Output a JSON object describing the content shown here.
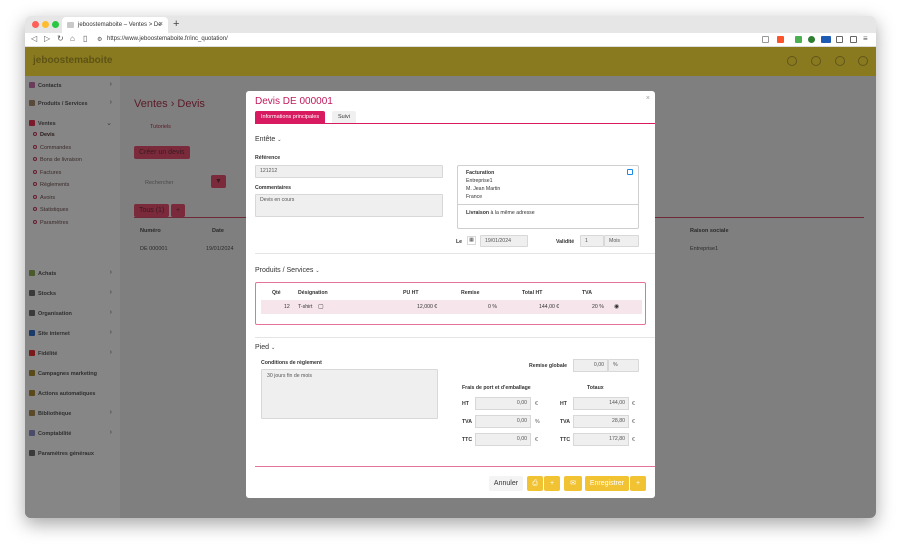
{
  "browser": {
    "tab_title": "jeboostemaboite – Ventes > De",
    "tab_close": "×",
    "new_tab": "+",
    "url": "https://www.jeboostemaboite.fr/inc_quotation/"
  },
  "app": {
    "logo": "jeboostemaboite",
    "sidebar": [
      {
        "label": "Contacts",
        "color": "#6a3b5a"
      },
      {
        "label": "Produits / Services",
        "color": "#5a4a3a"
      },
      {
        "label": "Ventes",
        "color": "#7a1a2a"
      },
      {
        "label": "Achats",
        "color": "#4a5a2a"
      },
      {
        "label": "Stocks",
        "color": "#3a3a3a"
      },
      {
        "label": "Organisation",
        "color": "#3a3a3a"
      },
      {
        "label": "Site internet",
        "color": "#1a3a6a"
      },
      {
        "label": "Fidélité",
        "color": "#7a1a1a"
      },
      {
        "label": "Campagnes marketing",
        "color": "#5a4a1a"
      },
      {
        "label": "Actions automatiques",
        "color": "#5a4a1a"
      },
      {
        "label": "Bibliothèque",
        "color": "#5a4a2a"
      },
      {
        "label": "Comptabilité",
        "color": "#4a4a6a"
      },
      {
        "label": "Paramètres généraux",
        "color": "#3a3a3a"
      }
    ],
    "sidebar_sub": [
      "Devis",
      "Commandes",
      "Bons de livraison",
      "Factures",
      "Règlements",
      "Avoirs",
      "Statistiques",
      "Paramètres"
    ],
    "page_title": "Ventes › Devis",
    "tutorials": "Tutoriels",
    "create_button": "Créer un devis",
    "search_placeholder": "Rechercher",
    "filter_tab": "Tous (1)",
    "bg_columns": [
      "Numéro",
      "Date",
      "Raison sociale"
    ],
    "bg_row": {
      "numero": "DE 000001",
      "date": "19/01/2024",
      "raison": "Entreprise1"
    }
  },
  "modal": {
    "title": "Devis DE 000001",
    "tab_main": "Informations principales",
    "tab_follow": "Suivi",
    "close": "×",
    "header_section": "Entête",
    "reference_label": "Référence",
    "reference_value": "121212",
    "comments_label": "Commentaires",
    "comments_value": "Devis en cours",
    "billing_title": "Facturation",
    "billing_lines": [
      "Entreprise1",
      "M. Jean Martin",
      "France"
    ],
    "delivery_label": "Livraison",
    "delivery_value": "à la même adresse",
    "date_label": "Le",
    "date_value": "19/01/2024",
    "validity_label": "Validité",
    "validity_value": "1",
    "validity_unit": "Mois",
    "products_section": "Produits / Services",
    "product_columns": [
      "Qté",
      "Désignation",
      "PU HT",
      "Remise",
      "Total HT",
      "TVA"
    ],
    "product_row": {
      "qty": "12",
      "designation": "T-shirt",
      "pu": "12,000 €",
      "remise": "0 %",
      "total": "144,00 €",
      "tva": "20 %"
    },
    "footer_section": "Pied",
    "conditions_label": "Conditions de règlement",
    "conditions_value": "30 jours fin de mois",
    "global_discount_label": "Remise globale",
    "global_discount_value": "0,00",
    "global_discount_unit": "%",
    "shipping_label": "Frais de port et d'emballage",
    "totals_label": "Totaux",
    "shipping_rows": [
      {
        "label": "HT",
        "value": "0,00",
        "unit": "€"
      },
      {
        "label": "TVA",
        "value": "0,00",
        "unit": "%"
      },
      {
        "label": "TTC",
        "value": "0,00",
        "unit": "€"
      }
    ],
    "total_rows": [
      {
        "label": "HT",
        "value": "144,00",
        "unit": "€"
      },
      {
        "label": "TVA",
        "value": "28,80",
        "unit": "€"
      },
      {
        "label": "TTC",
        "value": "172,80",
        "unit": "€"
      }
    ],
    "cancel_button": "Annuler",
    "save_button": "Enregistrer",
    "plus": "+"
  },
  "colors": {
    "accent": "#d81b60",
    "primary_button": "#f1c232"
  }
}
